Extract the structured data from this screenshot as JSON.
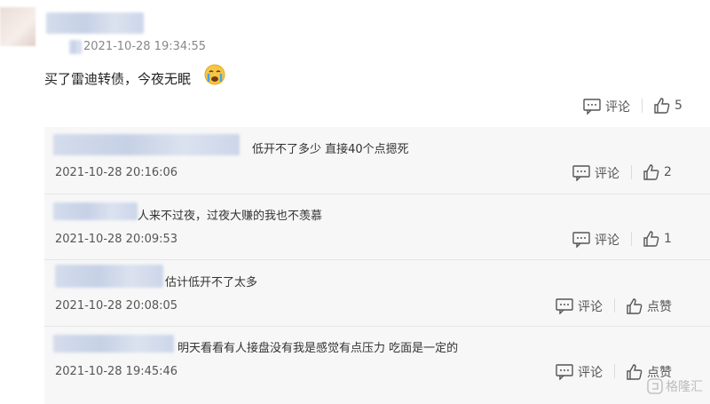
{
  "main_comment": {
    "time": "2021-10-28 19:34:55",
    "text": "买了雷迪转债，今夜无眠",
    "comment_label": "评论",
    "like_count": "5"
  },
  "replies": [
    {
      "text": "低开不了多少 直接40个点摁死",
      "time": "2021-10-28 20:16:06",
      "comment_label": "评论",
      "like_label": "2"
    },
    {
      "text": "人来不过夜，过夜大赚的我也不羡慕",
      "time": "2021-10-28 20:09:53",
      "comment_label": "评论",
      "like_label": "1"
    },
    {
      "text": "估计低开不了太多",
      "time": "2021-10-28 20:08:05",
      "comment_label": "评论",
      "like_label": "点赞"
    },
    {
      "text": "明天看看有人接盘没有我是感觉有点压力 吃面是一定的",
      "time": "2021-10-28 19:45:46",
      "comment_label": "评论",
      "like_label": "点赞"
    }
  ],
  "watermark": "格隆汇"
}
